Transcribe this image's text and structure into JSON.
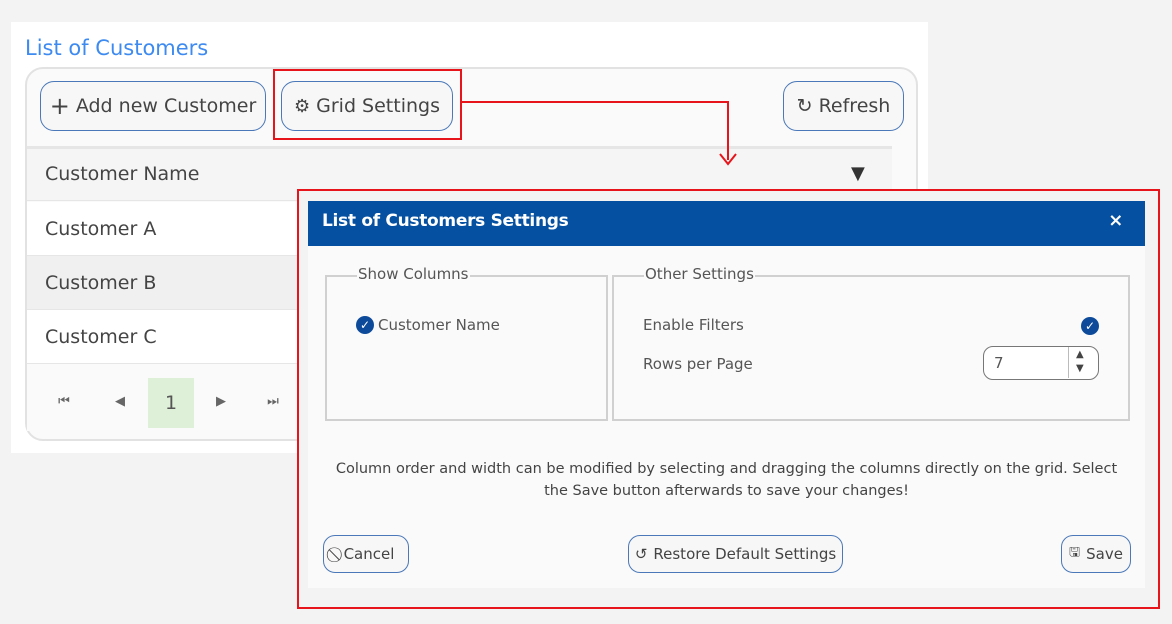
{
  "page": {
    "title": "List of Customers"
  },
  "toolbar": {
    "add_label": "Add new Customer",
    "grid_settings_label": "Grid Settings",
    "refresh_label": "Refresh"
  },
  "grid": {
    "column_header": "Customer Name",
    "rows": [
      "Customer A",
      "Customer B",
      "Customer C"
    ],
    "current_page": "1"
  },
  "dialog": {
    "title": "List of Customers Settings",
    "close": "×",
    "show_columns": {
      "legend": "Show Columns",
      "items": [
        {
          "label": "Customer Name",
          "checked": true
        }
      ]
    },
    "other_settings": {
      "legend": "Other Settings",
      "enable_filters_label": "Enable Filters",
      "enable_filters": true,
      "rows_per_page_label": "Rows per Page",
      "rows_per_page": "7"
    },
    "note": "Column order and width can be modified by selecting and dragging the columns directly on the grid. Select the Save button afterwards to save your changes!",
    "cancel_label": "Cancel",
    "restore_label": "Restore Default Settings",
    "save_label": "Save"
  },
  "colors": {
    "accent": "#0550a0",
    "highlight": "#e8141b",
    "title": "#3d8af0",
    "current_page_bg": "#dff0d8"
  }
}
